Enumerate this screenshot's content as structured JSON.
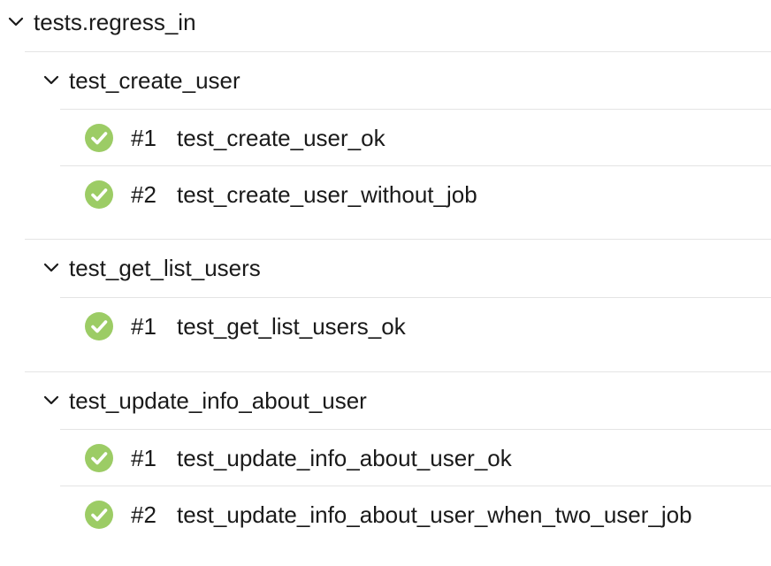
{
  "root": {
    "label": "tests.regress_in"
  },
  "groups": [
    {
      "label": "test_create_user",
      "cases": [
        {
          "num": "#1",
          "name": "test_create_user_ok",
          "status": "passed"
        },
        {
          "num": "#2",
          "name": "test_create_user_without_job",
          "status": "passed"
        }
      ]
    },
    {
      "label": "test_get_list_users",
      "cases": [
        {
          "num": "#1",
          "name": "test_get_list_users_ok",
          "status": "passed"
        }
      ]
    },
    {
      "label": "test_update_info_about_user",
      "cases": [
        {
          "num": "#1",
          "name": "test_update_info_about_user_ok",
          "status": "passed"
        },
        {
          "num": "#2",
          "name": "test_update_info_about_user_when_two_user_job",
          "status": "passed"
        }
      ]
    }
  ],
  "icons": {
    "expanded": "chevron-down-icon",
    "passed": "check-circle-icon"
  },
  "colors": {
    "passed": "#9ccc65",
    "separator": "#e4e4e4",
    "text": "#1a1a1a"
  }
}
